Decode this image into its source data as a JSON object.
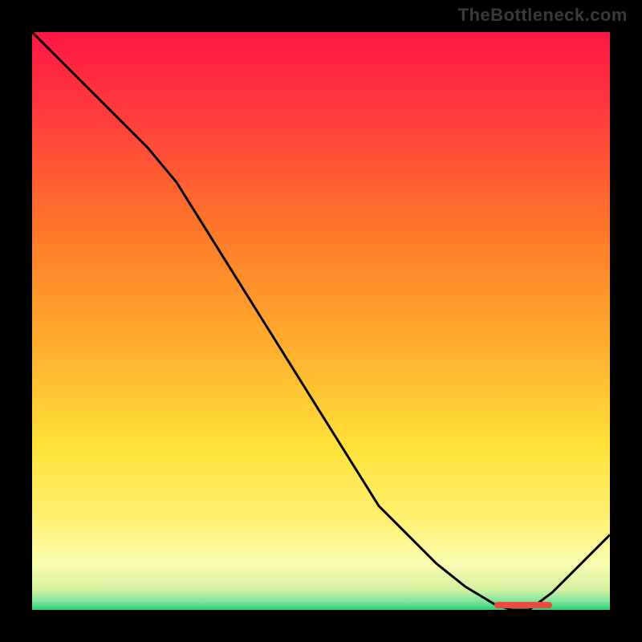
{
  "attribution": "TheBottleneck.com",
  "chart_data": {
    "type": "line",
    "title": "",
    "xlabel": "",
    "ylabel": "",
    "x": [
      0.0,
      0.05,
      0.1,
      0.15,
      0.2,
      0.25,
      0.3,
      0.35,
      0.4,
      0.45,
      0.5,
      0.55,
      0.6,
      0.65,
      0.7,
      0.75,
      0.8,
      0.83,
      0.86,
      0.9,
      0.95,
      1.0
    ],
    "values": [
      1.0,
      0.95,
      0.9,
      0.85,
      0.8,
      0.74,
      0.66,
      0.58,
      0.5,
      0.42,
      0.34,
      0.26,
      0.18,
      0.13,
      0.08,
      0.04,
      0.01,
      0.0,
      0.0,
      0.03,
      0.08,
      0.13
    ],
    "xlim": [
      0,
      1
    ],
    "ylim": [
      0,
      1
    ],
    "min_marker": {
      "label": "",
      "x_start": 0.8,
      "x_end": 0.9,
      "color": "#e74c3c"
    },
    "background_gradient": [
      {
        "offset": 0.0,
        "color": "#ff1744"
      },
      {
        "offset": 0.15,
        "color": "#ff3d3d"
      },
      {
        "offset": 0.35,
        "color": "#ff7a29"
      },
      {
        "offset": 0.55,
        "color": "#ffb02e"
      },
      {
        "offset": 0.72,
        "color": "#ffe23a"
      },
      {
        "offset": 0.85,
        "color": "#fff176"
      },
      {
        "offset": 0.92,
        "color": "#f9fbb2"
      },
      {
        "offset": 0.965,
        "color": "#d4f0a0"
      },
      {
        "offset": 0.985,
        "color": "#7fe6a1"
      },
      {
        "offset": 1.0,
        "color": "#2ecc71"
      }
    ]
  }
}
